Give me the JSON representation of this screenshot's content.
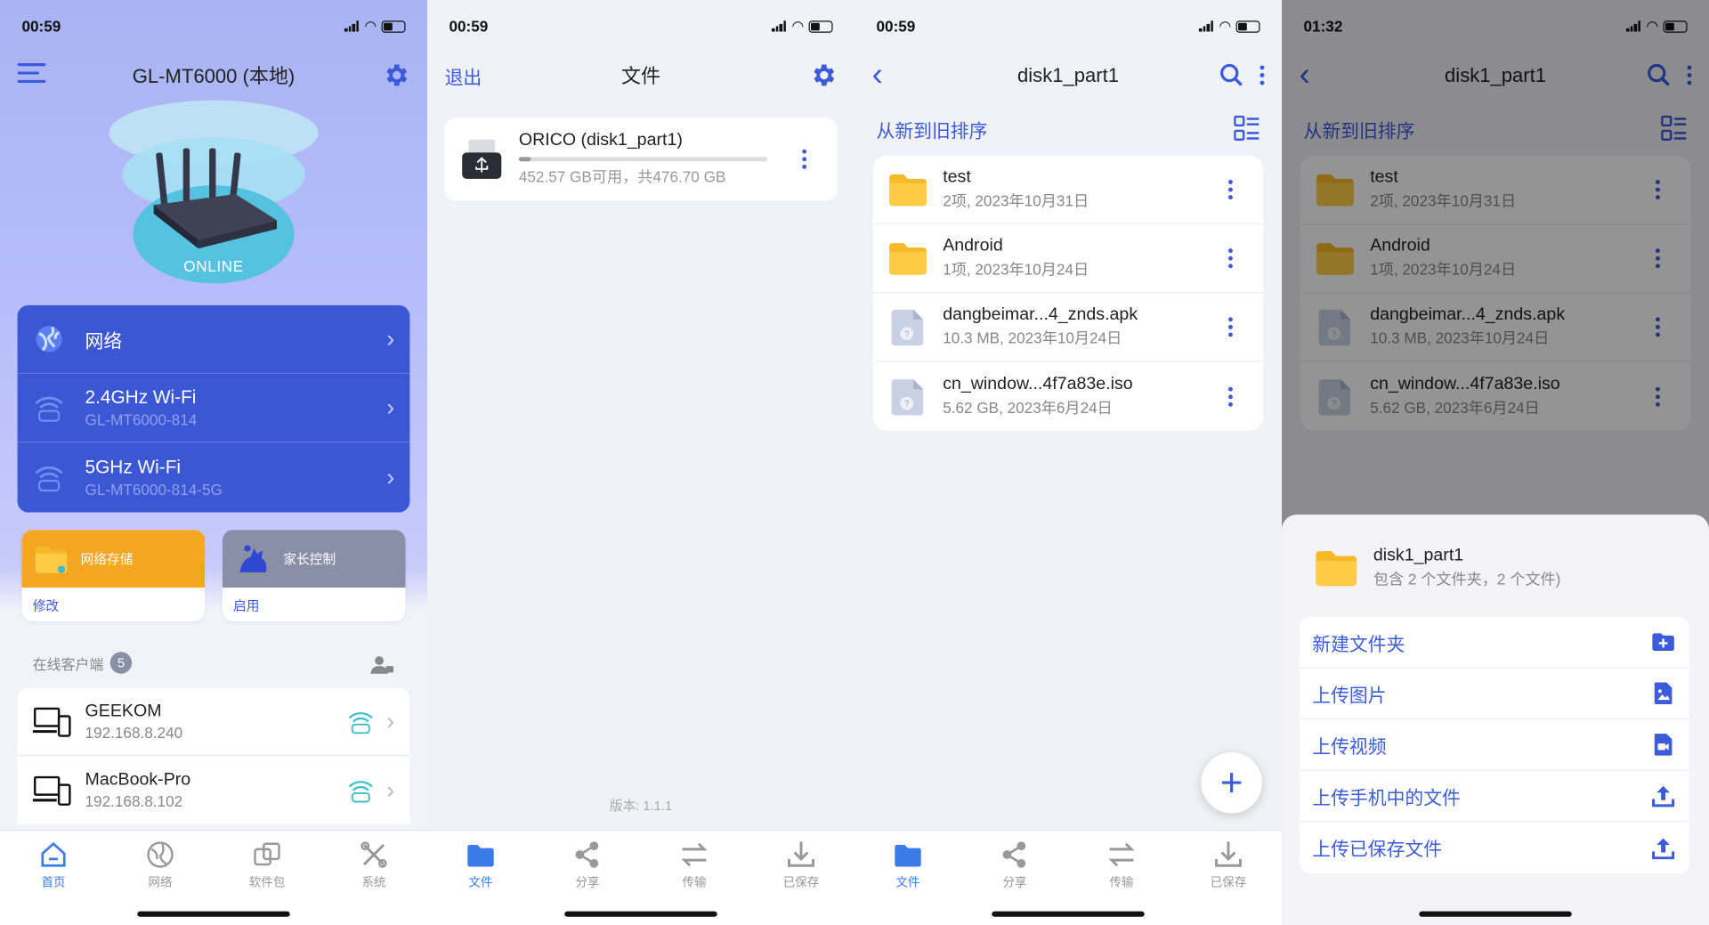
{
  "colors": {
    "accent": "#3b5bdb",
    "network_card": "#3b57d4",
    "storage_tile": "#f5a623",
    "parental_tile": "#8a8fa8",
    "online": "#3fb8d8"
  },
  "panel1": {
    "status": {
      "time": "00:59"
    },
    "title": "GL-MT6000 (本地)",
    "router_status": "ONLINE",
    "network": [
      {
        "title": "网络",
        "sub": ""
      },
      {
        "title": "2.4GHz Wi-Fi",
        "sub": "GL-MT6000-814",
        "band": "2.4G"
      },
      {
        "title": "5GHz Wi-Fi",
        "sub": "GL-MT6000-814-5G",
        "band": "5G"
      }
    ],
    "tiles": [
      {
        "title": "网络存储",
        "action": "修改"
      },
      {
        "title": "家长控制",
        "action": "启用"
      }
    ],
    "clients_label": "在线客户端",
    "clients_count": "5",
    "clients": [
      {
        "name": "GEEKOM",
        "ip": "192.168.8.240"
      },
      {
        "name": "MacBook-Pro",
        "ip": "192.168.8.102"
      }
    ],
    "tabs": [
      "首页",
      "网络",
      "软件包",
      "系统"
    ]
  },
  "panel2": {
    "status": {
      "time": "00:59"
    },
    "left": "退出",
    "title": "文件",
    "disk": {
      "name": "ORICO (disk1_part1)",
      "size": "452.57 GB可用，共476.70 GB",
      "used_fraction": 0.05
    },
    "version": "版本: 1.1.1",
    "tabs": [
      "文件",
      "分享",
      "传输",
      "已保存"
    ]
  },
  "panel3": {
    "status": {
      "time": "00:59"
    },
    "title": "disk1_part1",
    "sort": "从新到旧排序",
    "files": [
      {
        "name": "test",
        "meta": "2项, 2023年10月31日",
        "kind": "folder"
      },
      {
        "name": "Android",
        "meta": "1项, 2023年10月24日",
        "kind": "folder"
      },
      {
        "name": "dangbeimar...4_znds.apk",
        "meta": "10.3 MB, 2023年10月24日",
        "kind": "file"
      },
      {
        "name": "cn_window...4f7a83e.iso",
        "meta": "5.62 GB, 2023年6月24日",
        "kind": "file"
      }
    ],
    "fab": "+",
    "tabs": [
      "文件",
      "分享",
      "传输",
      "已保存"
    ]
  },
  "panel4": {
    "status": {
      "time": "01:32"
    },
    "title": "disk1_part1",
    "sort": "从新到旧排序",
    "files": [
      {
        "name": "test",
        "meta": "2项, 2023年10月31日"
      },
      {
        "name": "Android",
        "meta": "1项, 2023年10月24日"
      },
      {
        "name": "dangbeimar...4_znds.apk",
        "meta": "10.3 MB, 2023年10月24日"
      },
      {
        "name": "cn_window...4f7a83e.iso",
        "meta": "5.62 GB, 2023年6月24日"
      }
    ],
    "sheet": {
      "name": "disk1_part1",
      "meta": "包含 2 个文件夹，2 个文件)",
      "actions": [
        "新建文件夹",
        "上传图片",
        "上传视频",
        "上传手机中的文件",
        "上传已保存文件"
      ]
    }
  }
}
